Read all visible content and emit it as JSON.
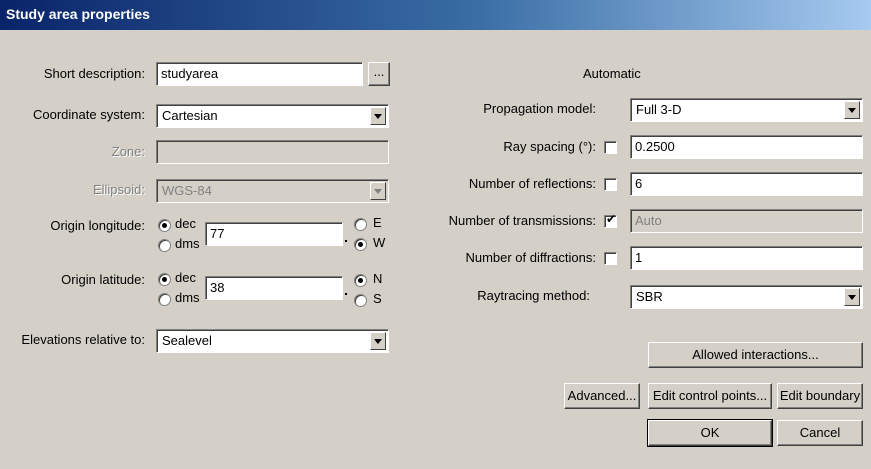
{
  "window": {
    "title": "Study area properties"
  },
  "left": {
    "short_description": {
      "label": "Short description:",
      "value": "studyarea",
      "browse_label": "..."
    },
    "coordinate_system": {
      "label": "Coordinate system:",
      "value": "Cartesian"
    },
    "zone": {
      "label": "Zone:",
      "value": ""
    },
    "ellipsoid": {
      "label": "Ellipsoid:",
      "value": "WGS-84"
    },
    "origin_longitude": {
      "label": "Origin longitude:",
      "format_dec": "dec",
      "format_dms": "dms",
      "selected_format": "dec",
      "value": "77",
      "dir_e": "E",
      "dir_w": "W",
      "selected_dir": "W"
    },
    "origin_latitude": {
      "label": "Origin latitude:",
      "format_dec": "dec",
      "format_dms": "dms",
      "selected_format": "dec",
      "value": "38",
      "dir_n": "N",
      "dir_s": "S",
      "selected_dir": "N"
    },
    "elevations": {
      "label": "Elevations relative to:",
      "value": "Sealevel"
    }
  },
  "right": {
    "automatic_header": "Automatic",
    "propagation_model": {
      "label": "Propagation model:",
      "value": "Full 3-D"
    },
    "ray_spacing": {
      "label": "Ray spacing (°):",
      "automatic": false,
      "value": "0.2500"
    },
    "num_reflections": {
      "label": "Number of reflections:",
      "automatic": false,
      "value": "6"
    },
    "num_transmissions": {
      "label": "Number of transmissions:",
      "automatic": true,
      "value": "Auto"
    },
    "num_diffractions": {
      "label": "Number of diffractions:",
      "automatic": false,
      "value": "1"
    },
    "raytracing_method": {
      "label": "Raytracing method:",
      "value": "SBR"
    }
  },
  "buttons": {
    "allowed_interactions": "Allowed interactions...",
    "advanced": "Advanced...",
    "edit_control_points": "Edit control points...",
    "edit_boundary": "Edit boundary",
    "ok": "OK",
    "cancel": "Cancel"
  }
}
